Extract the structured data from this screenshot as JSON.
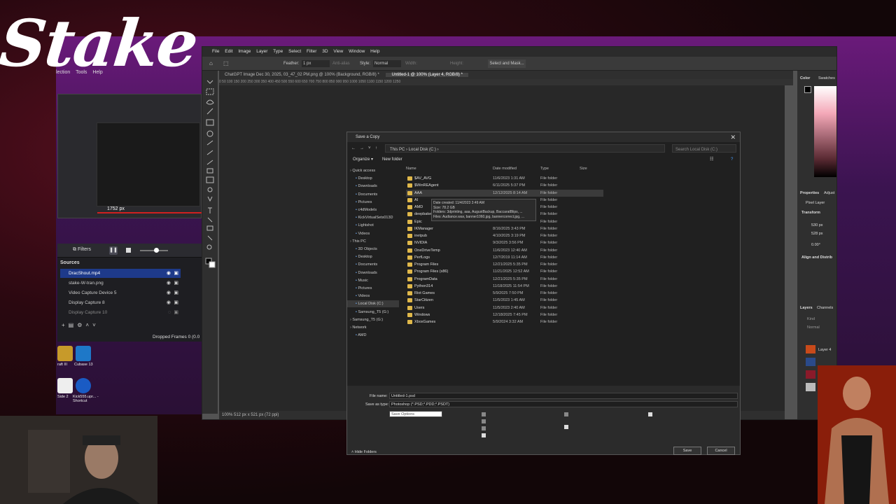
{
  "logo": {
    "text": "Stake"
  },
  "obs": {
    "menu": [
      "lection",
      "Tools",
      "Help"
    ],
    "resolution_px": "1752 px",
    "filters_label": "Filters",
    "sources_header": "Sources",
    "sources": [
      {
        "label": "DracShout.mp4",
        "selected": true
      },
      {
        "label": "stake-W-tran.png",
        "selected": false
      },
      {
        "label": "Video Capture Device 5",
        "selected": false
      },
      {
        "label": "Display Capture 8",
        "selected": false
      },
      {
        "label": "Display Capture 10",
        "selected": false
      }
    ],
    "dropped_frames": "Dropped Frames 0 (0.0"
  },
  "desktop_icons": [
    {
      "label": "raft III"
    },
    {
      "label": "Cubase 13"
    },
    {
      "label": "Side 2"
    },
    {
      "label": "Kick555.upr... - Shortcut"
    }
  ],
  "photoshop": {
    "menu": [
      "File",
      "Edit",
      "Image",
      "Layer",
      "Type",
      "Select",
      "Filter",
      "3D",
      "View",
      "Window",
      "Help"
    ],
    "options": {
      "feather_label": "Feather:",
      "feather_value": "1 px",
      "anti_alias": "Anti-alias",
      "style_label": "Style:",
      "style_value": "Normal",
      "width_label": "Width:",
      "height_label": "Height:",
      "select_mask": "Select and Mask..."
    },
    "tabs": [
      {
        "label": "ChatGPT Image Dec 30, 2025, 03_47_02 PM.png @ 100% (Background, RGB/8) *",
        "active": false
      },
      {
        "label": "Untitled-1 @ 100% (Layer 4, RGB/8) *",
        "active": true
      }
    ],
    "ruler": "0 50 100 150 200 250 300 350 400 450 500 550 600 650 700 750 800 850 900 950 1000 1050 1100 1150 1200 1250",
    "status": "100%     512 px x 521 px (72 ppi)",
    "panels": {
      "color_tab": "Color",
      "swatches_tab": "Swatches",
      "properties_tab": "Properties",
      "adjust_tab": "Adjust",
      "pixel_layer": "Pixel Layer",
      "transform": "Transform",
      "w_value": "530 px",
      "h_value": "528 px",
      "angle": "0.00°",
      "align": "Align and Distrib",
      "layers_tab": "Layers",
      "channels_tab": "Channels",
      "kind": "Kind",
      "blend": "Normal",
      "layer_name": "Layer 4"
    }
  },
  "dialog": {
    "title": "Save a Copy",
    "breadcrumb": "This PC  ›  Local Disk (C:)  ›",
    "search_placeholder": "Search Local Disk (C:)",
    "organize": "Organize ▾",
    "new_folder": "New folder",
    "columns": {
      "name": "Name",
      "date": "Date modified",
      "type": "Type",
      "size": "Size"
    },
    "nav": [
      {
        "label": "Quick access",
        "indent": 0,
        "selected": false
      },
      {
        "label": "Desktop",
        "indent": 1,
        "selected": false
      },
      {
        "label": "Downloads",
        "indent": 1,
        "selected": false
      },
      {
        "label": "Documents",
        "indent": 1,
        "selected": false
      },
      {
        "label": "Pictures",
        "indent": 1,
        "selected": false
      },
      {
        "label": "c4dModels",
        "indent": 1,
        "selected": false
      },
      {
        "label": "KickVirtualSets013D",
        "indent": 1,
        "selected": false
      },
      {
        "label": "Lightshot",
        "indent": 1,
        "selected": false
      },
      {
        "label": "Videos",
        "indent": 1,
        "selected": false
      },
      {
        "label": "This PC",
        "indent": 0,
        "selected": false
      },
      {
        "label": "3D Objects",
        "indent": 1,
        "selected": false
      },
      {
        "label": "Desktop",
        "indent": 1,
        "selected": false
      },
      {
        "label": "Documents",
        "indent": 1,
        "selected": false
      },
      {
        "label": "Downloads",
        "indent": 1,
        "selected": false
      },
      {
        "label": "Music",
        "indent": 1,
        "selected": false
      },
      {
        "label": "Pictures",
        "indent": 1,
        "selected": false
      },
      {
        "label": "Videos",
        "indent": 1,
        "selected": false
      },
      {
        "label": "Local Disk (C:)",
        "indent": 1,
        "selected": true
      },
      {
        "label": "Samsung_T5 (G:)",
        "indent": 1,
        "selected": false
      },
      {
        "label": "Samsung_T5 (G:)",
        "indent": 0,
        "selected": false
      },
      {
        "label": "Network",
        "indent": 0,
        "selected": false
      },
      {
        "label": "AMD",
        "indent": 1,
        "selected": false
      }
    ],
    "files": [
      {
        "name": "$AV_AVG",
        "date": "11/6/2023 1:31 AM",
        "type": "File folder"
      },
      {
        "name": "$WinREAgent",
        "date": "6/11/2025 5:37 PM",
        "type": "File folder"
      },
      {
        "name": "AAA",
        "date": "12/12/2025 8:14 AM",
        "type": "File folder",
        "highlight": true
      },
      {
        "name": "AI",
        "date": "",
        "type": "File folder"
      },
      {
        "name": "AMD",
        "date": "",
        "type": "File folder"
      },
      {
        "name": "deepbaker",
        "date": "",
        "type": "File folder"
      },
      {
        "name": "Epic",
        "date": "",
        "type": "File folder"
      },
      {
        "name": "IKManager",
        "date": "8/16/2025 3:43 PM",
        "type": "File folder"
      },
      {
        "name": "inetpub",
        "date": "4/10/2025 3:19 PM",
        "type": "File folder"
      },
      {
        "name": "NVIDIA",
        "date": "9/3/2025 3:56 PM",
        "type": "File folder"
      },
      {
        "name": "OneDriveTemp",
        "date": "11/6/2023 12:40 AM",
        "type": "File folder"
      },
      {
        "name": "PerfLogs",
        "date": "12/7/2019 11:14 AM",
        "type": "File folder"
      },
      {
        "name": "Program Files",
        "date": "12/21/2025 5:35 PM",
        "type": "File folder"
      },
      {
        "name": "Program Files (x86)",
        "date": "11/21/2025 12:52 AM",
        "type": "File folder"
      },
      {
        "name": "ProgramData",
        "date": "12/21/2025 5:35 PM",
        "type": "File folder"
      },
      {
        "name": "Python314",
        "date": "11/18/2025 11:54 PM",
        "type": "File folder"
      },
      {
        "name": "Riot Games",
        "date": "5/9/2025 7:50 PM",
        "type": "File folder"
      },
      {
        "name": "StarCitizen",
        "date": "11/5/2023 1:45 AM",
        "type": "File folder"
      },
      {
        "name": "Users",
        "date": "11/5/2023 2:40 AM",
        "type": "File folder"
      },
      {
        "name": "Windows",
        "date": "12/18/2025 7:45 PM",
        "type": "File folder"
      },
      {
        "name": "XboxGames",
        "date": "5/9/2024 3:32 AM",
        "type": "File folder"
      }
    ],
    "tooltip": "Date created: 11/4/2023 3:49 AM\nSize: 78.2 GB\nFolders: 3dprinting, aaa, AugustBackup, BaccaratBlips, ...\nFiles: Audiance.wav, banner1060.jpg, bannercorrect.jpg, ...",
    "file_name_label": "File name:",
    "file_name_value": "Untitled-1.psd",
    "save_type_label": "Save as type:",
    "save_type_value": "Photoshop (*.PSD;*.PDD;*.PSDT)",
    "options_button": "Save Options",
    "save_button": "Save",
    "cancel_button": "Cancel",
    "hide_folders": "Hide Folders"
  }
}
